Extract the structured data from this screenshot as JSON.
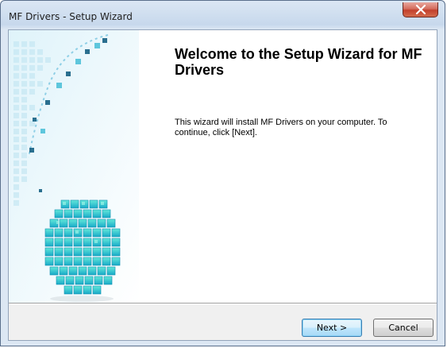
{
  "window": {
    "title": "MF Drivers - Setup Wizard",
    "close_label": "x"
  },
  "wizard": {
    "heading": "Welcome to the Setup Wizard for MF Drivers",
    "description": "This wizard will install MF Drivers on your computer. To continue, click [Next]."
  },
  "buttons": {
    "next_label": "Next >",
    "cancel_label": "Cancel"
  },
  "colors": {
    "accent_teal": "#2ec9c4",
    "close_red": "#c2402c"
  }
}
